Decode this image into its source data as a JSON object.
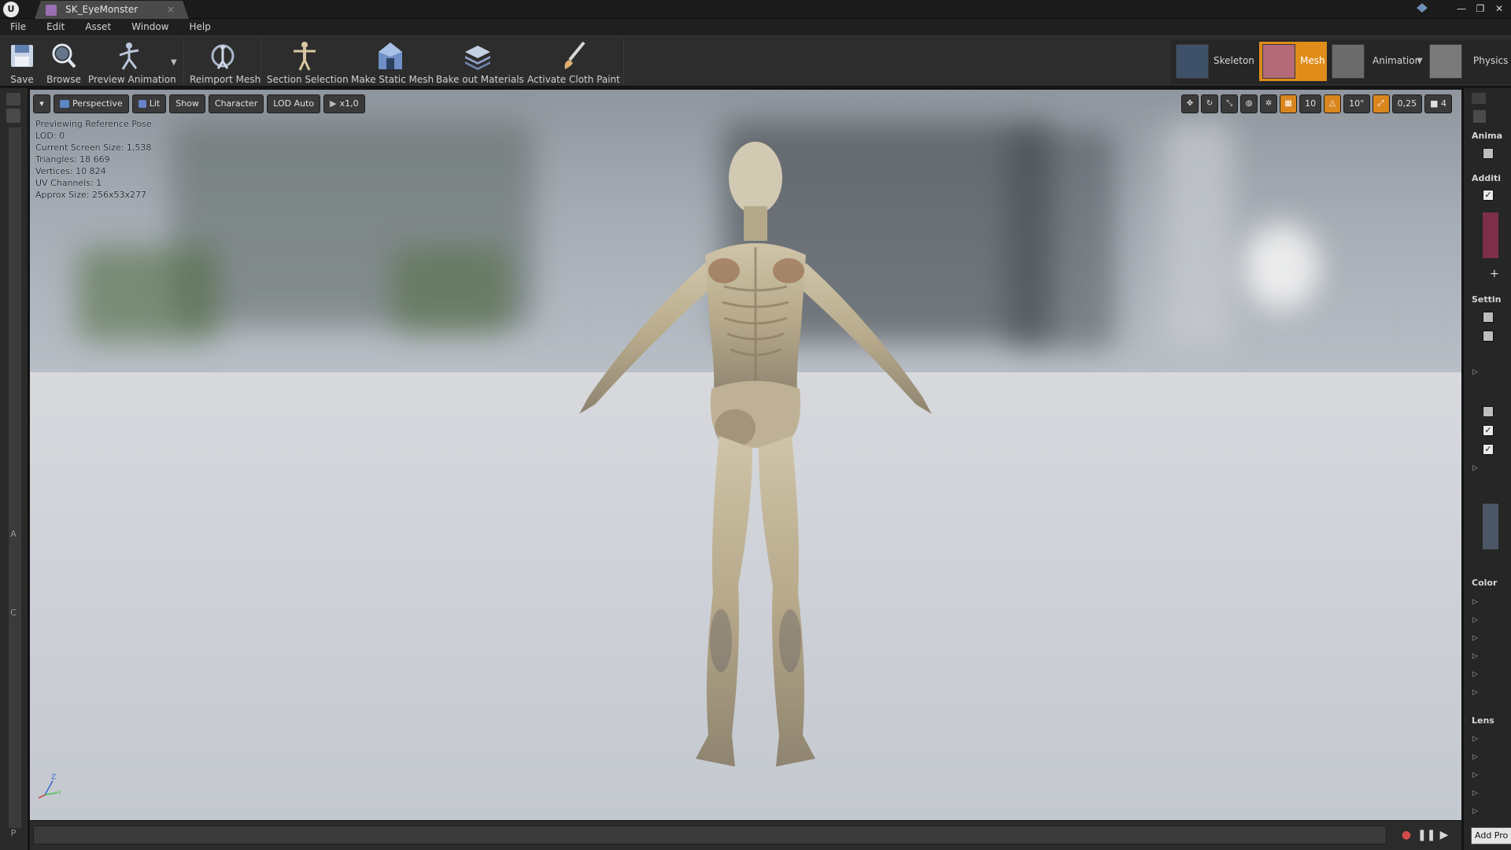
{
  "window": {
    "tab_title": "SK_EyeMonster",
    "tab_close": "×",
    "controls": [
      "—",
      "❐",
      "✕"
    ]
  },
  "menu": [
    "File",
    "Edit",
    "Asset",
    "Window",
    "Help"
  ],
  "toolbar": {
    "buttons": [
      {
        "label": "Save",
        "icon": "save-icon"
      },
      {
        "label": "Browse",
        "icon": "browse-icon"
      },
      {
        "label": "Preview Animation",
        "icon": "preview-animation-icon"
      },
      {
        "label": "Reimport Mesh",
        "icon": "reimport-icon"
      },
      {
        "label": "Section Selection",
        "icon": "section-selection-icon"
      },
      {
        "label": "Make Static Mesh",
        "icon": "static-mesh-icon"
      },
      {
        "label": "Bake out Materials",
        "icon": "bake-materials-icon"
      },
      {
        "label": "Activate Cloth Paint",
        "icon": "cloth-paint-icon"
      }
    ],
    "modes": [
      {
        "label": "Skeleton",
        "active": false
      },
      {
        "label": "Mesh",
        "active": true
      },
      {
        "label": "Animation",
        "active": false
      },
      {
        "label": "Physics",
        "active": false
      }
    ],
    "accent_color": "#e08c1a"
  },
  "viewport": {
    "buttons": {
      "view_mode": "Perspective",
      "lighting": "Lit",
      "show": "Show",
      "character": "Character",
      "lod": "LOD Auto",
      "speed": "x1,0"
    },
    "right_controls": {
      "grid_snap": "10",
      "rotation_snap": "10°",
      "scale_snap": "0,25",
      "camera_speed": "4"
    },
    "stats": [
      "Previewing Reference Pose",
      "LOD: 0",
      "Current Screen Size: 1,538",
      "Triangles: 18 669",
      "Vertices: 10 824",
      "UV Channels: 1",
      "Approx Size: 256x53x277"
    ],
    "axis_labels": {
      "z": "Z",
      "y": "Y"
    }
  },
  "right_panel": {
    "sections": [
      "Anima",
      "Additi",
      "Settin",
      "Color",
      "Lens"
    ],
    "add_button": "Add Pro"
  },
  "left_panel": {
    "marks": [
      "A",
      "C",
      "P"
    ]
  }
}
